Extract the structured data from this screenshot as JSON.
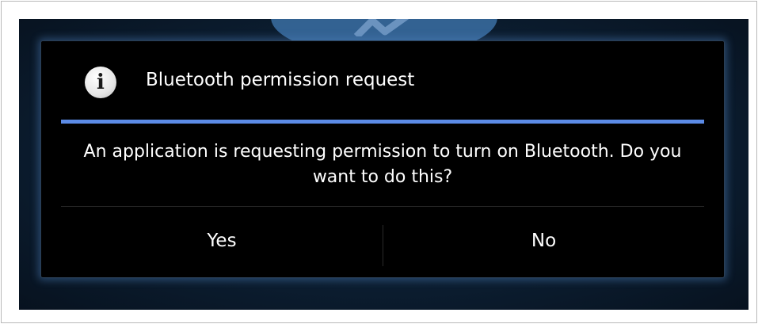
{
  "dialog": {
    "title": "Bluetooth permission request",
    "title_icon": "info-icon",
    "message": "An application is requesting permission to turn on Bluetooth. Do you want to do this?",
    "buttons": {
      "yes_label": "Yes",
      "no_label": "No"
    }
  },
  "colors": {
    "accent_divider": "#5c8be6",
    "dialog_background": "#000000",
    "text": "#ffffff"
  }
}
